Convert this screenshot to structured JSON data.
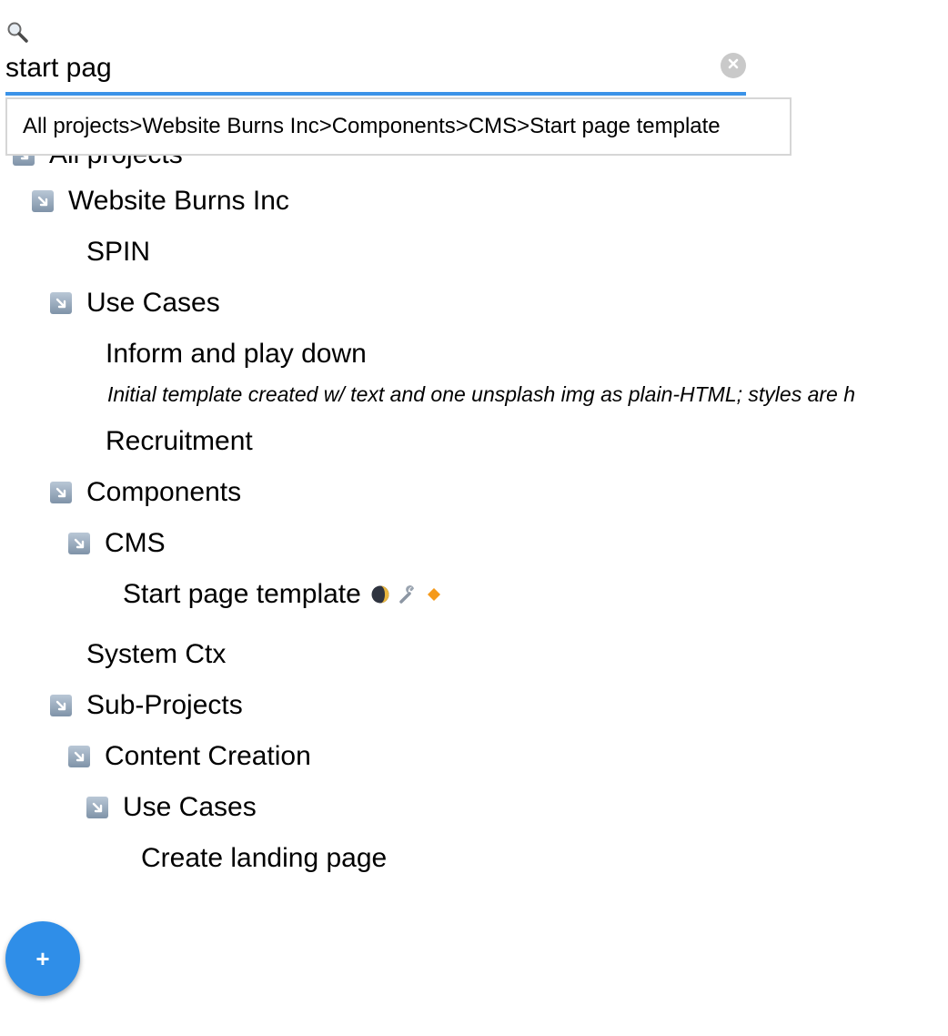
{
  "search": {
    "value": "start pag",
    "icon": "magnifier-icon",
    "clear_icon": "clear-icon",
    "accent_color": "#3b93e8"
  },
  "suggestion": {
    "crumbs": [
      "All projects",
      "Website Burns Inc",
      "Components",
      "CMS",
      "Start page template"
    ],
    "separator": ">"
  },
  "tree": {
    "root_label": "All projects",
    "items": [
      {
        "label": "Website Burns Inc",
        "expanded": true
      },
      {
        "label": "SPIN"
      },
      {
        "label": "Use Cases",
        "expanded": true
      },
      {
        "label": "Inform and play down",
        "note": "Initial template created w/ text and one unsplash img as plain-HTML; styles are h"
      },
      {
        "label": "Recruitment"
      },
      {
        "label": "Components",
        "expanded": true
      },
      {
        "label": "CMS",
        "expanded": true
      },
      {
        "label": "Start page template",
        "badges": [
          "moon-icon",
          "wrench-icon",
          "diamond-icon"
        ]
      },
      {
        "label": "System Ctx"
      },
      {
        "label": "Sub-Projects",
        "expanded": true
      },
      {
        "label": "Content Creation",
        "expanded": true
      },
      {
        "label": "Use Cases",
        "expanded": true
      },
      {
        "label": "Create landing page"
      }
    ]
  },
  "fab": {
    "label": "+",
    "color": "#2f8ee8"
  }
}
